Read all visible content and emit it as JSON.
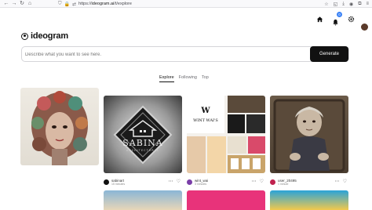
{
  "browser": {
    "url_prefix": "https://",
    "url_host": "ideogram.ai",
    "url_path": "/t/explore"
  },
  "header": {
    "logo_text": "ideogram",
    "notification_count": "0"
  },
  "search": {
    "placeholder": "Describe what you want to see here.",
    "generate_label": "Generate"
  },
  "tabs": [
    {
      "label": "Explore"
    },
    {
      "label": "Following"
    },
    {
      "label": "Top"
    }
  ],
  "cards": [
    {
      "user": "",
      "time": "",
      "avatar_color": "#7a3e2e"
    },
    {
      "user": "sabinart",
      "time": "15 minutes",
      "avatar_color": "#111111"
    },
    {
      "user": "wint_wai",
      "time": "3 minutes",
      "avatar_color": "#7a3ea8"
    },
    {
      "user": "user_20495",
      "time": "1 minute",
      "avatar_color": "#c0224f"
    }
  ]
}
